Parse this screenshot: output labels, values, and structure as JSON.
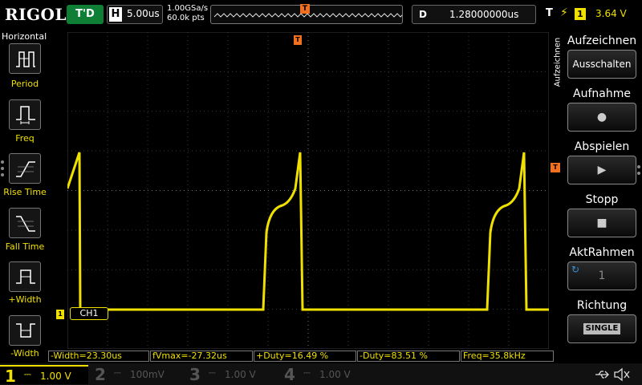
{
  "topbar": {
    "logo": "RIGOL",
    "run_state": "T'D",
    "timebase_label": "H",
    "timebase_value": "5.00us",
    "sample_rate": "1.00GSa/s",
    "memory_depth": "60.0k pts",
    "trigger_position_mark": "T",
    "delay_label": "D",
    "delay_value": "1.28000000us",
    "trigger_label": "T",
    "trigger_edge": "rising-edge-icon",
    "trigger_source": "1",
    "trigger_level": "3.64 V"
  },
  "left_menu": {
    "title": "Horizontal",
    "items": [
      {
        "label": "Period",
        "icon": "period-icon"
      },
      {
        "label": "Freq",
        "icon": "frequency-icon"
      },
      {
        "label": "Rise Time",
        "icon": "rise-time-icon"
      },
      {
        "label": "Fall Time",
        "icon": "fall-time-icon"
      },
      {
        "label": "+Width",
        "icon": "positive-width-icon"
      },
      {
        "label": "-Width",
        "icon": "negative-width-icon"
      }
    ]
  },
  "screen": {
    "trigger_position_marker": "T",
    "trigger_level_marker": "T",
    "ch1_marker": "1",
    "ch1_tag": "CH1",
    "waveform_color": "#f0e000",
    "grid_color": "#3a3a3a"
  },
  "right_menu": {
    "vertical_label": "Aufzeichnen",
    "buttons": [
      {
        "title": "Aufzeichnen",
        "value": "Ausschalten"
      },
      {
        "title": "Aufnahme",
        "glyph": "●"
      },
      {
        "title": "Abspielen",
        "glyph": "▶"
      },
      {
        "title": "Stopp",
        "glyph": "■"
      },
      {
        "title": "AktRahmen",
        "value": "1"
      },
      {
        "title": "Richtung",
        "badge": "SINGLE"
      }
    ]
  },
  "measurements": [
    {
      "text": "-Width=23.30us"
    },
    {
      "text": "fVmax=-27.32us"
    },
    {
      "text": "+Duty=16.49 %"
    },
    {
      "text": "-Duty=83.51 %"
    },
    {
      "text": "Freq=35.8kHz"
    }
  ],
  "channels": [
    {
      "num": "1",
      "scale": "1.00 V",
      "color": "#f0e000"
    },
    {
      "num": "2",
      "scale": "100mV",
      "color": "#00c0c0"
    },
    {
      "num": "3",
      "scale": "1.00 V",
      "color": "#c000c0"
    },
    {
      "num": "4",
      "scale": "1.00 V",
      "color": "#2060ff"
    }
  ],
  "status_icons": [
    "usb-icon",
    "speaker-mute-icon"
  ]
}
